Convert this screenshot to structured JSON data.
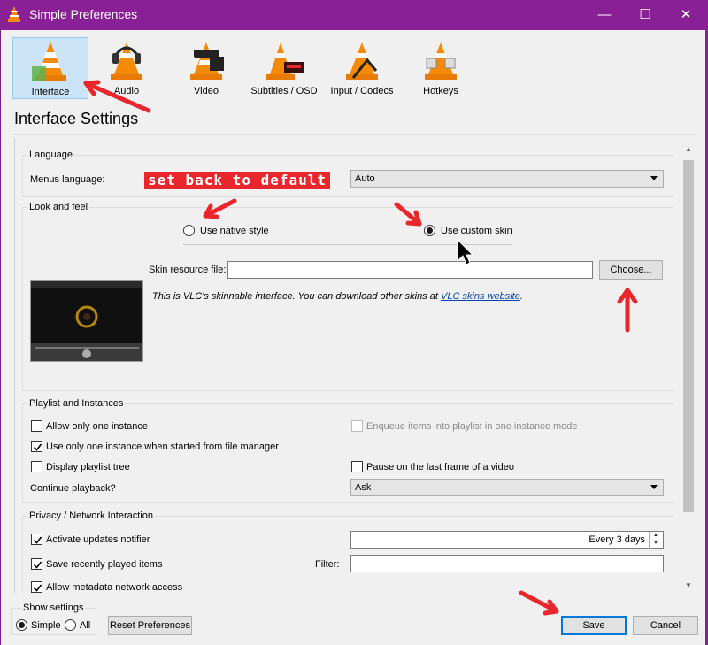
{
  "window": {
    "title": "Simple Preferences",
    "controls": {
      "minimize": "—",
      "maximize": "☐",
      "close": "✕"
    }
  },
  "categories": [
    {
      "label": "Interface",
      "icon": "vlc-cone-interface-icon",
      "selected": true
    },
    {
      "label": "Audio",
      "icon": "vlc-cone-headphones-icon",
      "selected": false
    },
    {
      "label": "Video",
      "icon": "vlc-cone-glasses-icon",
      "selected": false
    },
    {
      "label": "Subtitles / OSD",
      "icon": "vlc-cone-subtitles-icon",
      "selected": false
    },
    {
      "label": "Input / Codecs",
      "icon": "vlc-cone-cable-icon",
      "selected": false
    },
    {
      "label": "Hotkeys",
      "icon": "vlc-cone-keys-icon",
      "selected": false
    }
  ],
  "page_title": "Interface Settings",
  "language": {
    "group_title": "Language",
    "menus_language_label": "Menus language:",
    "menus_language_value": "Auto"
  },
  "look_and_feel": {
    "group_title": "Look and feel",
    "native_style_label": "Use native style",
    "custom_skin_label": "Use custom skin",
    "selected_style": "custom",
    "skin_file_label": "Skin resource file:",
    "skin_file_value": "",
    "choose_button": "Choose...",
    "info_text": "This is VLC's skinnable interface. You can download other skins at",
    "info_link": "VLC skins website",
    "info_end": "."
  },
  "playlist": {
    "group_title": "Playlist and Instances",
    "allow_one_instance": {
      "label": "Allow only one instance",
      "checked": false
    },
    "file_manager_instance": {
      "label": "Use only one instance when started from file manager",
      "checked": true
    },
    "enqueue_items": {
      "label": "Enqueue items into playlist in one instance mode",
      "checked": false,
      "disabled": true
    },
    "playlist_tree": {
      "label": "Display playlist tree",
      "checked": false
    },
    "pause_last_frame": {
      "label": "Pause on the last frame of a video",
      "checked": false
    },
    "continue_playback_label": "Continue playback?",
    "continue_playback_value": "Ask"
  },
  "privacy": {
    "group_title": "Privacy / Network Interaction",
    "updates_notifier": {
      "label": "Activate updates notifier",
      "checked": true
    },
    "updates_interval": "Every 3 days",
    "recently_played": {
      "label": "Save recently played items",
      "checked": true
    },
    "filter_label": "Filter:",
    "filter_value": "",
    "metadata_access": {
      "label": "Allow metadata network access",
      "checked": true
    }
  },
  "footer": {
    "show_settings_title": "Show settings",
    "simple_label": "Simple",
    "all_label": "All",
    "selected_mode": "simple",
    "reset_button": "Reset Preferences",
    "save_button": "Save",
    "cancel_button": "Cancel"
  },
  "annotations": {
    "note_text": "set back to default",
    "arrow_color": "#e8262c"
  },
  "colors": {
    "titlebar": "#8a2096",
    "selected_category": "#cce4f7",
    "default_button_border": "#0078d7",
    "link": "#0645ad"
  }
}
